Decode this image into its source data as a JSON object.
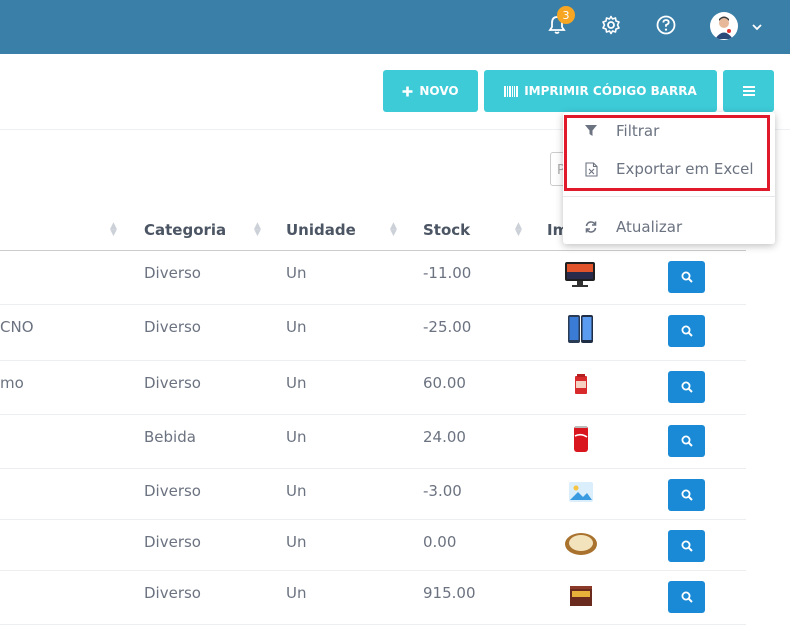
{
  "header": {
    "notification_count": "3",
    "icons": [
      "bell-icon",
      "gear-icon",
      "help-icon",
      "avatar",
      "chevron-down-icon"
    ]
  },
  "toolbar": {
    "new_label": "NOVO",
    "barcode_label": "IMPRIMIR CÓDIGO BARRA"
  },
  "search": {
    "placeholder": "P"
  },
  "table": {
    "columns": [
      "Categoria",
      "Unidade",
      "Stock",
      "Im"
    ],
    "rows": [
      {
        "name": "",
        "category": "Diverso",
        "unit": "Un",
        "stock": "-11.00",
        "image": "monitor"
      },
      {
        "name": "CNO",
        "category": "Diverso",
        "unit": "Un",
        "stock": "-25.00",
        "image": "phone"
      },
      {
        "name": "mo",
        "category": "Diverso",
        "unit": "Un",
        "stock": "60.00",
        "image": "package"
      },
      {
        "name": "",
        "category": "Bebida",
        "unit": "Un",
        "stock": "24.00",
        "image": "can"
      },
      {
        "name": "",
        "category": "Diverso",
        "unit": "Un",
        "stock": "-3.00",
        "image": "placeholder-image"
      },
      {
        "name": "",
        "category": "Diverso",
        "unit": "Un",
        "stock": "0.00",
        "image": "bread"
      },
      {
        "name": "",
        "category": "Diverso",
        "unit": "Un",
        "stock": "915.00",
        "image": "box"
      }
    ]
  },
  "menu": {
    "items": [
      {
        "label": "Filtrar",
        "icon": "filter-icon"
      },
      {
        "label": "Exportar em Excel",
        "icon": "excel-file-icon"
      },
      {
        "label": "Atualizar",
        "icon": "refresh-icon"
      }
    ]
  },
  "colors": {
    "topbar": "#3a7fa8",
    "button": "#3ecbd8",
    "view_button": "#1a8ad6",
    "badge": "#f6a623",
    "highlight": "#e01a2b"
  }
}
